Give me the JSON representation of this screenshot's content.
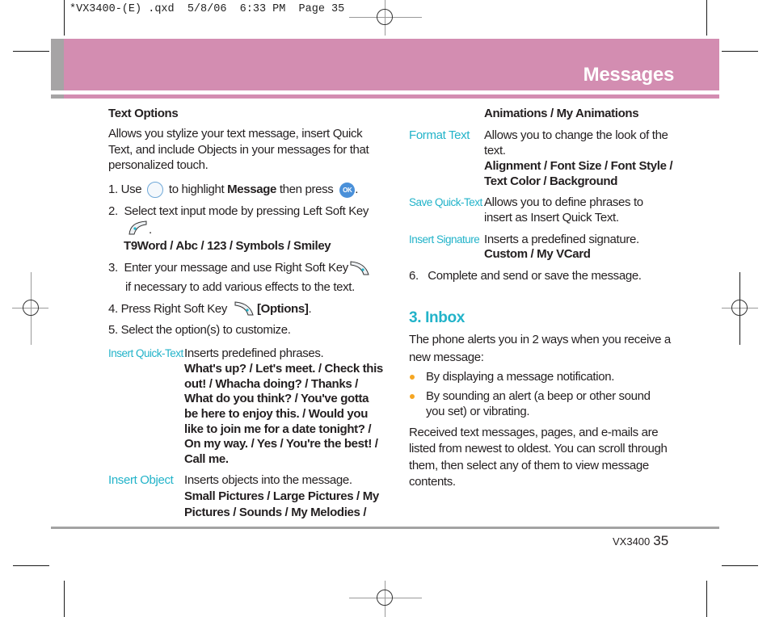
{
  "slug": "*VX3400-(E) .qxd  5/8/06  6:33 PM  Page 35",
  "header": {
    "title": "Messages",
    "band_color": "#d38db1",
    "tab_color": "#a6a4a5"
  },
  "left": {
    "heading": "Text Options",
    "intro": [
      "Allows you stylize your text message, insert Quick",
      "Text, and include Objects in your messages for that",
      "personalized touch."
    ],
    "step1": {
      "num": "1.",
      "pre": "Use",
      "mid": "to highlight",
      "bold": "Message",
      "post": "then press",
      "end": "."
    },
    "step2": {
      "num": "2.",
      "text": "Select text input mode by pressing Left Soft Key",
      "end": ".",
      "options": "T9Word / Abc / 123 / Symbols / Smiley"
    },
    "step3": {
      "num": "3.",
      "line1": "Enter your message and use Right Soft Key",
      "line2": "if necessary to add various effects to the text."
    },
    "step4": {
      "num": "4.",
      "text": "Press Right Soft Key",
      "bold": "[Options]",
      "end": "."
    },
    "step5": {
      "num": "5.",
      "text": "Select the option(s) to customize."
    },
    "quick_text": {
      "label": "Insert Quick-Text",
      "desc": "Inserts predefined phrases.",
      "options": [
        "What's up? / Let's meet. / Check this",
        "out! / Whacha doing? / Thanks /",
        "What do you think? / You've gotta",
        "be here to enjoy this. / Would you",
        "like to join me for a date tonight? /",
        "On my way. / Yes / You're the best! /",
        "Call me."
      ]
    },
    "insert_object": {
      "label": "Insert Object",
      "desc": "Inserts objects into the message.",
      "options": [
        "Small Pictures / Large Pictures / My",
        "Pictures / Sounds / My Melodies /"
      ]
    }
  },
  "right": {
    "cont": "Animations / My Animations",
    "format_text": {
      "label": "Format Text",
      "desc": [
        "Allows you to change the look of the",
        "text."
      ],
      "options": [
        "Alignment / Font Size / Font Style /",
        "Text Color / Background"
      ]
    },
    "save_quick": {
      "label": "Save Quick-Text",
      "desc": [
        "Allows you to define phrases to",
        "insert as Insert Quick Text."
      ]
    },
    "insert_sig": {
      "label": "Insert Signature",
      "desc": "Inserts a predefined signature.",
      "options": "Custom / My VCard"
    },
    "step6": {
      "num": "6.",
      "text": "Complete and send or save the message."
    },
    "inbox": {
      "heading": "3. Inbox",
      "intro": [
        "The phone alerts you in 2 ways when you receive a",
        "new message:"
      ],
      "bullets": [
        [
          "By displaying a message notification."
        ],
        [
          "By sounding an alert (a beep or other sound",
          "you set) or vibrating."
        ]
      ],
      "body": [
        "Received text messages, pages, and e-mails are",
        "listed from newest to oldest. You can scroll through",
        "them, then select any of them to view message",
        "contents."
      ]
    }
  },
  "footer": {
    "model": "VX3400",
    "page": "35"
  },
  "colors": {
    "accent": "#22b3c9",
    "bullet": "#f5a623"
  },
  "icons": {
    "nav": "navigation-key-icon",
    "ok": "ok-key-icon",
    "ok_label": "OK",
    "left_soft": "left-soft-key-icon",
    "right_soft": "right-soft-key-icon"
  }
}
